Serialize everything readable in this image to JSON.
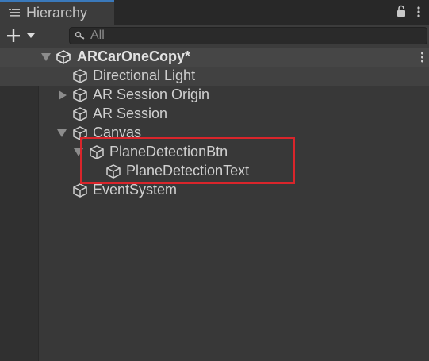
{
  "tab": {
    "title": "Hierarchy",
    "icon": "hierarchy-list-icon",
    "accent": "#3a79bb"
  },
  "toolbar": {
    "add_icon": "plus-dropdown-icon",
    "search_placeholder": "All",
    "search_icon": "search-icon"
  },
  "scene": {
    "name": "ARCarOneCopy*",
    "icon": "unity-logo-icon"
  },
  "items": [
    {
      "label": "Directional Light",
      "icon": "gameobject-cube-icon",
      "foldout": "none",
      "depth": 0
    },
    {
      "label": "AR Session Origin",
      "icon": "gameobject-cube-icon",
      "foldout": "collapsed",
      "depth": 0
    },
    {
      "label": "AR Session",
      "icon": "gameobject-cube-icon",
      "foldout": "none",
      "depth": 0
    },
    {
      "label": "Canvas",
      "icon": "gameobject-cube-icon",
      "foldout": "expanded",
      "depth": 0
    },
    {
      "label": "PlaneDetectionBtn",
      "icon": "gameobject-cube-icon",
      "foldout": "expanded",
      "depth": 1
    },
    {
      "label": "PlaneDetectionText",
      "icon": "gameobject-cube-icon",
      "foldout": "none",
      "depth": 2
    },
    {
      "label": "EventSystem",
      "icon": "gameobject-cube-icon",
      "foldout": "none",
      "depth": 0
    }
  ],
  "annotation": {
    "color": "#d9252b"
  }
}
